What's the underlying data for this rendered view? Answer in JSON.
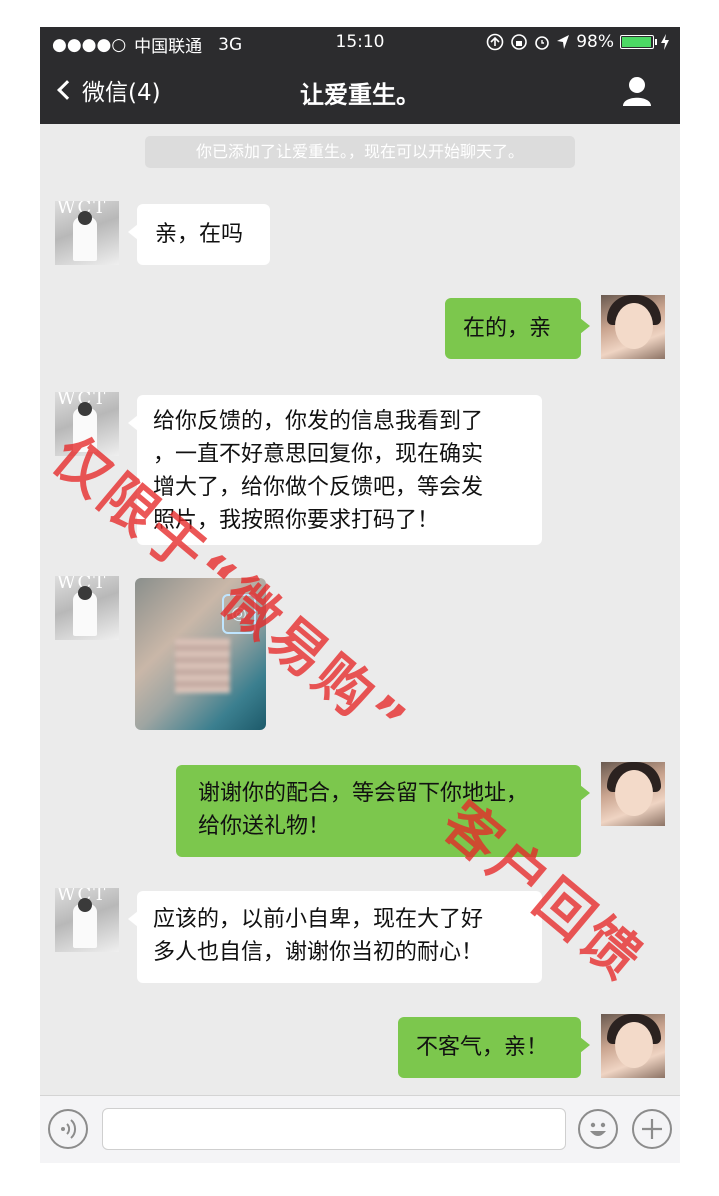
{
  "status_bar": {
    "signal": "●●●●○",
    "carrier": "中国联通",
    "network": "3G",
    "time": "15:10",
    "battery": "98%",
    "battery_level": 0.98
  },
  "nav": {
    "back_label": "微信(4)",
    "title": "让爱重生。"
  },
  "system_message": "你已添加了让爱重生。，现在可以开始聊天了。",
  "messages": [
    {
      "side": "in",
      "text": "亲，在吗"
    },
    {
      "side": "out",
      "text": "在的，亲"
    },
    {
      "side": "in",
      "lines": [
        "给你反馈的，你发的信息我看到了",
        "，一直不好意思回复你，现在确实",
        "增大了，给你做个反馈吧，等会发",
        "照片，我按照你要求打码了！"
      ]
    },
    {
      "side": "in",
      "type": "image"
    },
    {
      "side": "out",
      "lines": [
        "谢谢你的配合，等会留下你地址，",
        "给你送礼物！"
      ]
    },
    {
      "side": "in",
      "lines": [
        "应该的，以前小自卑，现在大了好",
        "多人也自信，谢谢你当初的耐心！"
      ]
    },
    {
      "side": "out",
      "text": "不客气，亲！"
    }
  ],
  "avatar_text": "WCT",
  "watermark": {
    "part1": "仅限于“微易购”",
    "part2": "客户回馈"
  },
  "colors": {
    "topbar": "#2c2c2e",
    "chat_bg": "#ebebeb",
    "out_bubble": "#7cc74d",
    "watermark": "#e62828"
  }
}
